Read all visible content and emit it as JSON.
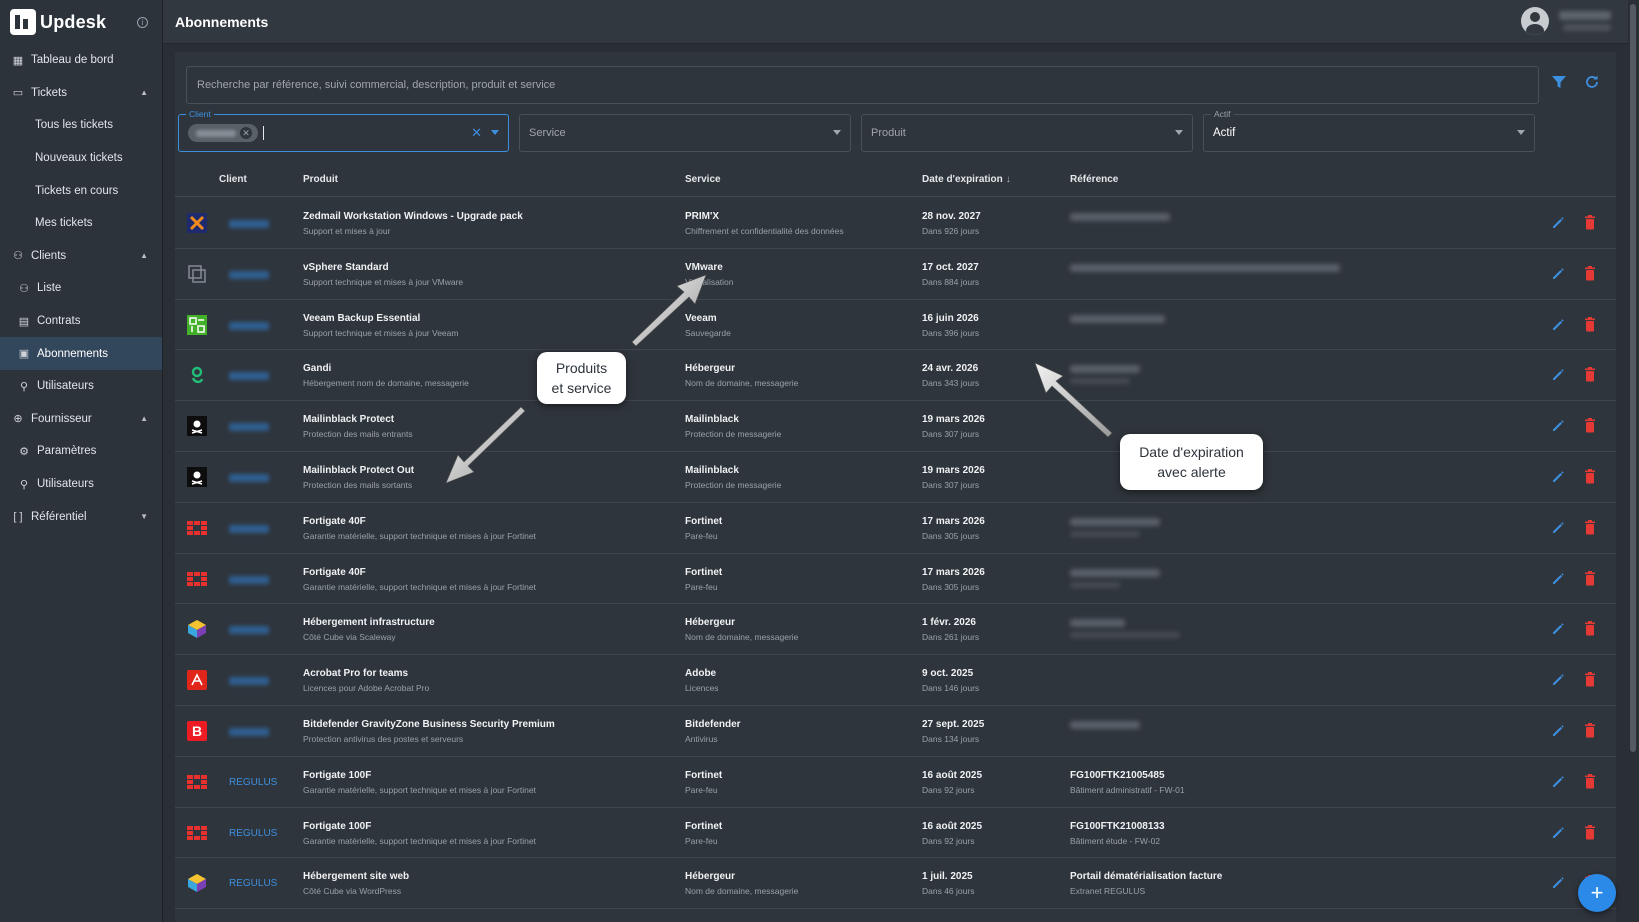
{
  "app": {
    "name": "Updesk",
    "page_title": "Abonnements"
  },
  "sidebar": {
    "items": [
      {
        "label": "Tableau de bord",
        "icon": "dashboard-icon",
        "level": "top"
      },
      {
        "label": "Tickets",
        "icon": "ticket-icon",
        "level": "top",
        "chevron": "up"
      },
      {
        "label": "Tous les tickets",
        "level": "sub"
      },
      {
        "label": "Nouveaux tickets",
        "level": "sub"
      },
      {
        "label": "Tickets en cours",
        "level": "sub"
      },
      {
        "label": "Mes tickets",
        "level": "sub"
      },
      {
        "label": "Clients",
        "icon": "clients-icon",
        "level": "top",
        "chevron": "up"
      },
      {
        "label": "Liste",
        "icon": "list-user-icon",
        "level": "sub-icon"
      },
      {
        "label": "Contrats",
        "icon": "contract-icon",
        "level": "sub-icon"
      },
      {
        "label": "Abonnements",
        "icon": "calendar-icon",
        "level": "sub-icon",
        "active": true
      },
      {
        "label": "Utilisateurs",
        "icon": "user-icon",
        "level": "sub-icon"
      },
      {
        "label": "Fournisseur",
        "icon": "globe-icon",
        "level": "top",
        "chevron": "up"
      },
      {
        "label": "Paramètres",
        "icon": "gear-icon",
        "level": "sub-icon"
      },
      {
        "label": "Utilisateurs",
        "icon": "user-icon",
        "level": "sub-icon"
      },
      {
        "label": "Référentiel",
        "icon": "brackets-icon",
        "level": "top",
        "chevron": "down"
      }
    ]
  },
  "filters": {
    "search_placeholder": "Recherche par référence, suivi commercial, description, produit et service",
    "client_label": "Client",
    "service_placeholder": "Service",
    "produit_placeholder": "Produit",
    "actif_label": "Actif",
    "actif_value": "Actif"
  },
  "table": {
    "headers": {
      "client": "Client",
      "produit": "Produit",
      "service": "Service",
      "expiration": "Date d'expiration",
      "reference": "Référence"
    },
    "rows": [
      {
        "logo": "zedmail-logo",
        "client": "",
        "produit": "Zedmail Workstation Windows - Upgrade pack",
        "produit_desc": "Support et mises à jour",
        "service": "PRIM'X",
        "service_desc": "Chiffrement et confidentialité des données",
        "date": "28 nov. 2027",
        "delay": "Dans 926 jours",
        "ref": "",
        "ref_desc": ""
      },
      {
        "logo": "vsphere-logo",
        "client": "",
        "produit": "vSphere Standard",
        "produit_desc": "Support technique et mises à jour VMware",
        "service": "VMware",
        "service_desc": "Virtualisation",
        "date": "17 oct. 2027",
        "delay": "Dans 884 jours",
        "ref": "",
        "ref_desc": ""
      },
      {
        "logo": "veeam-logo",
        "client": "",
        "produit": "Veeam Backup Essential",
        "produit_desc": "Support technique et mises à jour Veeam",
        "service": "Veeam",
        "service_desc": "Sauvegarde",
        "date": "16 juin 2026",
        "delay": "Dans 396 jours",
        "ref": "",
        "ref_desc": ""
      },
      {
        "logo": "gandi-logo",
        "client": "",
        "produit": "Gandi",
        "produit_desc": "Hébergement nom de domaine, messagerie",
        "service": "Hébergeur",
        "service_desc": "Nom de domaine, messagerie",
        "date": "24 avr. 2026",
        "delay": "Dans 343 jours",
        "ref": "",
        "ref_desc": ""
      },
      {
        "logo": "mailinblack-logo",
        "client": "",
        "produit": "Mailinblack Protect",
        "produit_desc": "Protection des mails entrants",
        "service": "Mailinblack",
        "service_desc": "Protection de messagerie",
        "date": "19 mars 2026",
        "delay": "Dans 307 jours",
        "ref": "",
        "ref_desc": ""
      },
      {
        "logo": "mailinblack-logo",
        "client": "",
        "produit": "Mailinblack Protect Out",
        "produit_desc": "Protection des mails sortants",
        "service": "Mailinblack",
        "service_desc": "Protection de messagerie",
        "date": "19 mars 2026",
        "delay": "Dans 307 jours",
        "ref": "",
        "ref_desc": ""
      },
      {
        "logo": "fortinet-logo",
        "client": "",
        "produit": "Fortigate 40F",
        "produit_desc": "Garantie matérielle, support technique et mises à jour Fortinet",
        "service": "Fortinet",
        "service_desc": "Pare-feu",
        "date": "17 mars 2026",
        "delay": "Dans 305 jours",
        "ref": "",
        "ref_desc": ""
      },
      {
        "logo": "fortinet-logo",
        "client": "",
        "produit": "Fortigate 40F",
        "produit_desc": "Garantie matérielle, support technique et mises à jour Fortinet",
        "service": "Fortinet",
        "service_desc": "Pare-feu",
        "date": "17 mars 2026",
        "delay": "Dans 305 jours",
        "ref": "",
        "ref_desc": ""
      },
      {
        "logo": "cube-logo",
        "client": "",
        "produit": "Hébergement infrastructure",
        "produit_desc": "Côté Cube via Scaleway",
        "service": "Hébergeur",
        "service_desc": "Nom de domaine, messagerie",
        "date": "1 févr. 2026",
        "delay": "Dans 261 jours",
        "ref": "",
        "ref_desc": ""
      },
      {
        "logo": "adobe-logo",
        "client": "",
        "produit": "Acrobat Pro for teams",
        "produit_desc": "Licences pour Adobe Acrobat Pro",
        "service": "Adobe",
        "service_desc": "Licences",
        "date": "9 oct. 2025",
        "delay": "Dans 146 jours",
        "ref": "",
        "ref_desc": ""
      },
      {
        "logo": "bitdefender-logo",
        "client": "",
        "produit": "Bitdefender GravityZone Business Security Premium",
        "produit_desc": "Protection antivirus des postes et serveurs",
        "service": "Bitdefender",
        "service_desc": "Antivirus",
        "date": "27 sept. 2025",
        "delay": "Dans 134 jours",
        "ref": "",
        "ref_desc": ""
      },
      {
        "logo": "fortinet-logo",
        "client": "REGULUS",
        "produit": "Fortigate 100F",
        "produit_desc": "Garantie matérielle, support technique et mises à jour Fortinet",
        "service": "Fortinet",
        "service_desc": "Pare-feu",
        "date": "16 août 2025",
        "delay": "Dans 92 jours",
        "ref": "FG100FTK21005485",
        "ref_desc": "Bâtiment administratif - FW-01"
      },
      {
        "logo": "fortinet-logo",
        "client": "REGULUS",
        "produit": "Fortigate 100F",
        "produit_desc": "Garantie matérielle, support technique et mises à jour Fortinet",
        "service": "Fortinet",
        "service_desc": "Pare-feu",
        "date": "16 août 2025",
        "delay": "Dans 92 jours",
        "ref": "FG100FTK21008133",
        "ref_desc": "Bâtiment étude - FW-02"
      },
      {
        "logo": "cube-logo",
        "client": "REGULUS",
        "produit": "Hébergement site web",
        "produit_desc": "Côté Cube via WordPress",
        "service": "Hébergeur",
        "service_desc": "Nom de domaine, messagerie",
        "date": "1 juil. 2025",
        "delay": "Dans 46 jours",
        "ref": "Portail dématérialisation facture",
        "ref_desc": "Extranet REGULUS"
      }
    ]
  },
  "callouts": {
    "produits": [
      "Produits",
      "et service"
    ],
    "expiration": [
      "Date d'expiration",
      "avec alerte"
    ]
  },
  "colors": {
    "accent": "#3d8fe0",
    "delete": "#e53935",
    "fab": "#2b8ae8"
  }
}
